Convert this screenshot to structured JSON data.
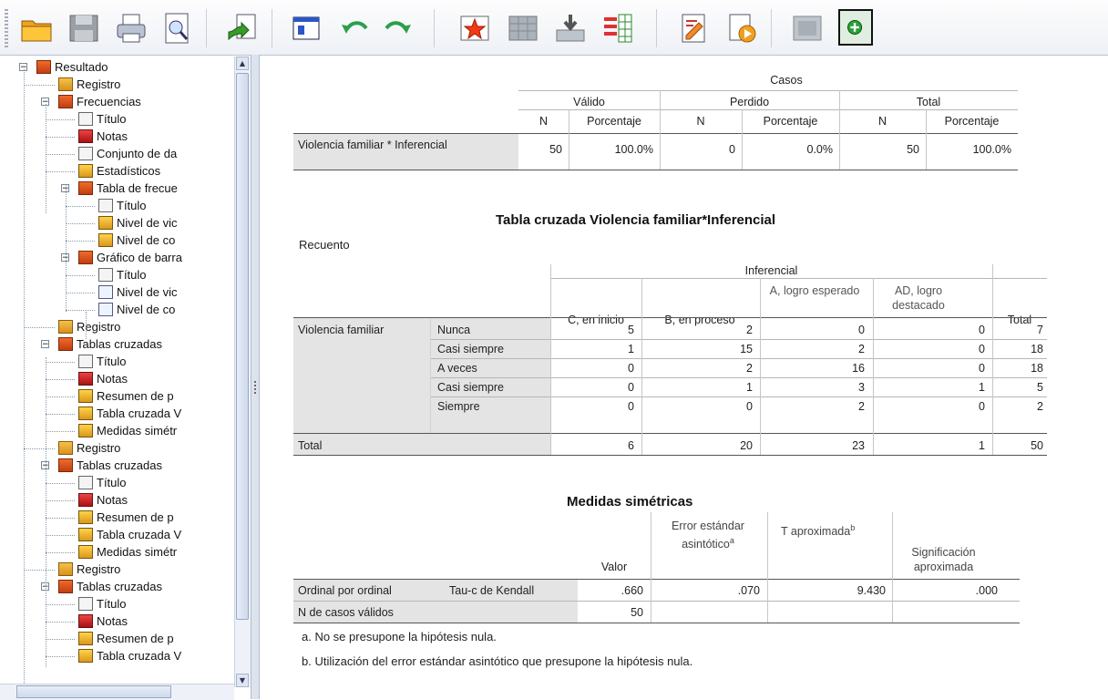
{
  "toolbar": {
    "buttons": [
      "open-icon",
      "save-icon",
      "print-icon",
      "print-preview-icon",
      "export-icon",
      "recall-dialog-icon",
      "undo-icon",
      "redo-icon",
      "goto-case-icon",
      "goto-variable-icon",
      "insert-cases-icon",
      "variables-icon",
      "designate-window-icon",
      "run-script-icon",
      "gray-placeholder-icon",
      "add-green-icon"
    ]
  },
  "tree": {
    "items": [
      {
        "label": "Resultado",
        "icon": "folder"
      },
      {
        "label": "Registro",
        "icon": "book"
      },
      {
        "label": "Frecuencias",
        "icon": "folder"
      },
      {
        "label": "Título",
        "icon": "page"
      },
      {
        "label": "Notas",
        "icon": "notes"
      },
      {
        "label": "Conjunto de da",
        "icon": "page"
      },
      {
        "label": "Estadísticos",
        "icon": "table"
      },
      {
        "label": "Tabla de frecue",
        "icon": "folder"
      },
      {
        "label": "Título",
        "icon": "page"
      },
      {
        "label": "Nivel de vic",
        "icon": "table"
      },
      {
        "label": "Nivel de co",
        "icon": "table"
      },
      {
        "label": "Gráfico de barra",
        "icon": "folder"
      },
      {
        "label": "Título",
        "icon": "page"
      },
      {
        "label": "Nivel de vic",
        "icon": "chart"
      },
      {
        "label": "Nivel de co",
        "icon": "chart"
      },
      {
        "label": "Registro",
        "icon": "book"
      },
      {
        "label": "Tablas cruzadas",
        "icon": "folder"
      },
      {
        "label": "Título",
        "icon": "page"
      },
      {
        "label": "Notas",
        "icon": "notes"
      },
      {
        "label": "Resumen de p",
        "icon": "table"
      },
      {
        "label": "Tabla cruzada V",
        "icon": "table"
      },
      {
        "label": "Medidas simétr",
        "icon": "table"
      },
      {
        "label": "Registro",
        "icon": "book"
      },
      {
        "label": "Tablas cruzadas",
        "icon": "folder"
      },
      {
        "label": "Título",
        "icon": "page"
      },
      {
        "label": "Notas",
        "icon": "notes"
      },
      {
        "label": "Resumen de p",
        "icon": "table"
      },
      {
        "label": "Tabla cruzada V",
        "icon": "table"
      },
      {
        "label": "Medidas simétr",
        "icon": "table"
      },
      {
        "label": "Registro",
        "icon": "book"
      },
      {
        "label": "Tablas cruzadas",
        "icon": "folder"
      },
      {
        "label": "Título",
        "icon": "page"
      },
      {
        "label": "Notas",
        "icon": "notes"
      },
      {
        "label": "Resumen de p",
        "icon": "table"
      },
      {
        "label": "Tabla cruzada V",
        "icon": "table"
      }
    ]
  },
  "summary": {
    "group": "Casos",
    "valid": "Válido",
    "missing": "Perdido",
    "total": "Total",
    "n": "N",
    "pct": "Porcentaje",
    "row_label": "Violencia familiar * Inferencial",
    "values": [
      "50",
      "100.0%",
      "0",
      "0.0%",
      "50",
      "100.0%"
    ]
  },
  "crosstab": {
    "title": "Tabla cruzada Violencia familiar*Inferencial",
    "subtitle": "Recuento",
    "col_group": "Inferencial",
    "cols": [
      "C, en inicio",
      "B, en proceso",
      "A, logro esperado",
      "AD, logro destacado",
      "Total"
    ],
    "row_group": "Violencia familiar",
    "rows": [
      {
        "label": "Nunca",
        "values": [
          "5",
          "2",
          "0",
          "0",
          "7"
        ]
      },
      {
        "label": "Casi siempre",
        "values": [
          "1",
          "15",
          "2",
          "0",
          "18"
        ]
      },
      {
        "label": "A veces",
        "values": [
          "0",
          "2",
          "16",
          "0",
          "18"
        ]
      },
      {
        "label": "Casi siempre",
        "values": [
          "0",
          "1",
          "3",
          "1",
          "5"
        ]
      },
      {
        "label": "Siempre",
        "values": [
          "0",
          "0",
          "2",
          "0",
          "2"
        ]
      }
    ],
    "total_label": "Total",
    "total_values": [
      "6",
      "20",
      "23",
      "1",
      "50"
    ]
  },
  "symmetric": {
    "title": "Medidas simétricas",
    "cols": [
      "Valor",
      "Error estándar asintótico",
      "T aproximada",
      "Significación aproximada"
    ],
    "sup_a": "a",
    "sup_b": "b",
    "row1_group": "Ordinal por ordinal",
    "row1_label": "Tau-c de Kendall",
    "row1_values": [
      ".660",
      ".070",
      "9.430",
      ".000"
    ],
    "row2_label": "N de casos válidos",
    "row2_value": "50",
    "note_a": "a. No se presupone la hipótesis nula.",
    "note_b": "b. Utilización del error estándar asintótico que presupone la hipótesis nula."
  }
}
